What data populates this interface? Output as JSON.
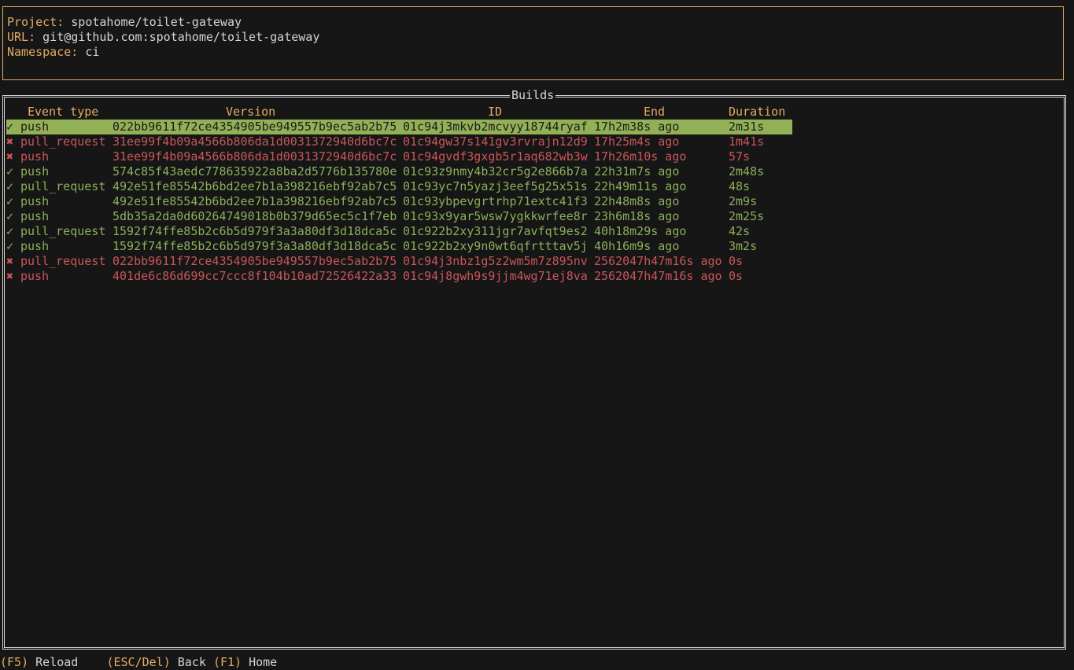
{
  "project": {
    "project_label": "Project:",
    "project_value": "spotahome/toilet-gateway",
    "url_label": "URL:",
    "url_value": "git@github.com:spotahome/toilet-gateway",
    "namespace_label": "Namespace:",
    "namespace_value": "ci"
  },
  "builds": {
    "title": "Builds",
    "headers": {
      "event_type": "Event type",
      "version": "Version",
      "id": "ID",
      "end": "End",
      "duration": "Duration"
    },
    "rows": [
      {
        "status": "✓",
        "event": "push",
        "version": "022bb9611f72ce4354905be949557b9ec5ab2b75",
        "id": "01c94j3mkvb2mcvyy18744ryaf",
        "end": "17h2m38s ago",
        "duration": "2m31s"
      },
      {
        "status": "✖",
        "event": "pull_request",
        "version": "31ee99f4b09a4566b806da1d0031372940d6bc7c",
        "id": "01c94gw37s141gv3rvrajn12d9",
        "end": "17h25m4s ago",
        "duration": "1m41s"
      },
      {
        "status": "✖",
        "event": "push",
        "version": "31ee99f4b09a4566b806da1d0031372940d6bc7c",
        "id": "01c94gvdf3gxgb5r1aq682wb3w",
        "end": "17h26m10s ago",
        "duration": "57s"
      },
      {
        "status": "✓",
        "event": "push",
        "version": "574c85f43aedc778635922a8ba2d5776b135780e",
        "id": "01c93z9nmy4b32cr5g2e866b7a",
        "end": "22h31m7s ago",
        "duration": "2m48s"
      },
      {
        "status": "✓",
        "event": "pull_request",
        "version": "492e51fe85542b6bd2ee7b1a398216ebf92ab7c5",
        "id": "01c93yc7n5yazj3eef5g25x51s",
        "end": "22h49m11s ago",
        "duration": "48s"
      },
      {
        "status": "✓",
        "event": "push",
        "version": "492e51fe85542b6bd2ee7b1a398216ebf92ab7c5",
        "id": "01c93ybpevgrtrhp71extc41f3",
        "end": "22h48m8s ago",
        "duration": "2m9s"
      },
      {
        "status": "✓",
        "event": "push",
        "version": "5db35a2da0d60264749018b0b379d65ec5c1f7eb",
        "id": "01c93x9yar5wsw7ygkkwrfee8r",
        "end": "23h6m18s ago",
        "duration": "2m25s"
      },
      {
        "status": "✓",
        "event": "pull_request",
        "version": "1592f74ffe85b2c6b5d979f3a3a80df3d18dca5c",
        "id": "01c922b2xy311jgr7avfqt9es2",
        "end": "40h18m29s ago",
        "duration": "42s"
      },
      {
        "status": "✓",
        "event": "push",
        "version": "1592f74ffe85b2c6b5d979f3a3a80df3d18dca5c",
        "id": "01c922b2xy9n0wt6qfrtttav5j",
        "end": "40h16m9s ago",
        "duration": "3m2s"
      },
      {
        "status": "✖",
        "event": "pull_request",
        "version": "022bb9611f72ce4354905be949557b9ec5ab2b75",
        "id": "01c94j3nbz1g5z2wm5m7z895nv",
        "end": "2562047h47m16s ago",
        "duration": "0s"
      },
      {
        "status": "✖",
        "event": "push",
        "version": "401de6c86d699cc7ccc8f104b10ad72526422a33",
        "id": "01c94j8gwh9s9jjm4wg71ej8va",
        "end": "2562047h47m16s ago",
        "duration": "0s"
      }
    ]
  },
  "footer": {
    "reload_key": "(F5)",
    "reload_label": "Reload",
    "back_key": "(ESC/Del)",
    "back_label": "Back",
    "home_key": "(F1)",
    "home_label": "Home"
  },
  "colors": {
    "accent": "#e4ac62",
    "success": "#8bb05a",
    "failure": "#c9565a",
    "selected_bg": "#92b055",
    "background": "#161616"
  }
}
